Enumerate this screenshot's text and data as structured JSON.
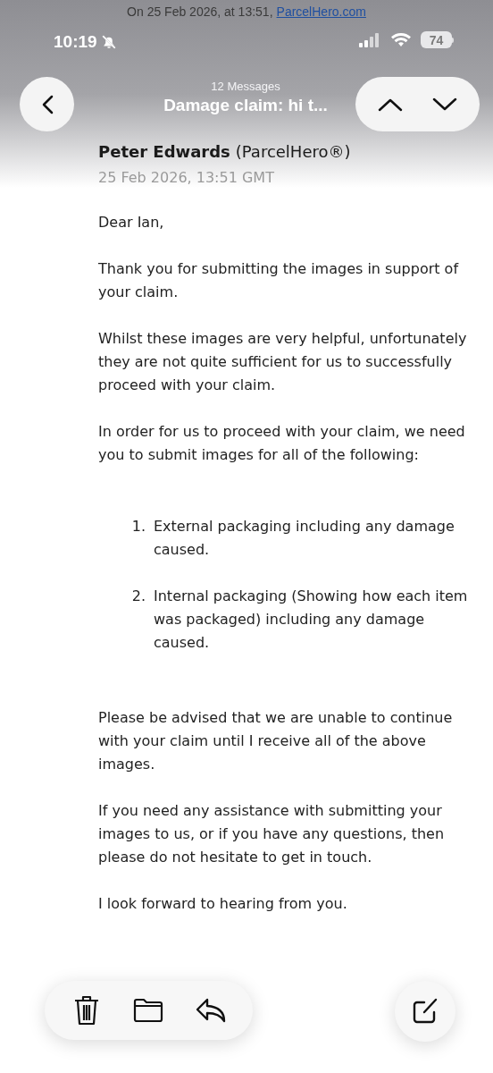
{
  "quoted_header": {
    "text": "On 25 Feb 2026, at 13:51,",
    "link": "ParcelHero.com"
  },
  "status_bar": {
    "time": "10:19",
    "silent": true,
    "battery": "74"
  },
  "nav": {
    "count": "12 Messages",
    "title": "Damage claim: hi t..."
  },
  "message": {
    "sender": "Peter Edwards",
    "organization": "(ParcelHero®)",
    "date": "25 Feb 2026, 13:51 GMT",
    "body": [
      {
        "kind": "paragraph",
        "text": "Dear Ian,"
      },
      {
        "kind": "paragraph",
        "text": "Thank you for submitting the images in support of your claim."
      },
      {
        "kind": "paragraph",
        "text": "Whilst these images are very helpful, unfortunately they are not quite sufficient for us to successfully proceed with your claim."
      },
      {
        "kind": "paragraph",
        "text": "In order for us to proceed with your claim, we need you to submit images for all of the following:"
      },
      {
        "kind": "list",
        "items": [
          {
            "number": "1.",
            "text": "External packaging including any damage caused."
          },
          {
            "number": "2.",
            "text": "Internal packaging (Showing how each item was packaged) including any damage caused."
          }
        ]
      },
      {
        "kind": "paragraph",
        "text": "Please be advised that we are unable to continue with your claim until I receive all of the above images."
      },
      {
        "kind": "paragraph",
        "text": "If you need any assistance with submitting your images to us, or if you have any questions, then please do not hesitate to get in touch."
      },
      {
        "kind": "paragraph",
        "text": "I look forward to hearing from you."
      }
    ]
  }
}
